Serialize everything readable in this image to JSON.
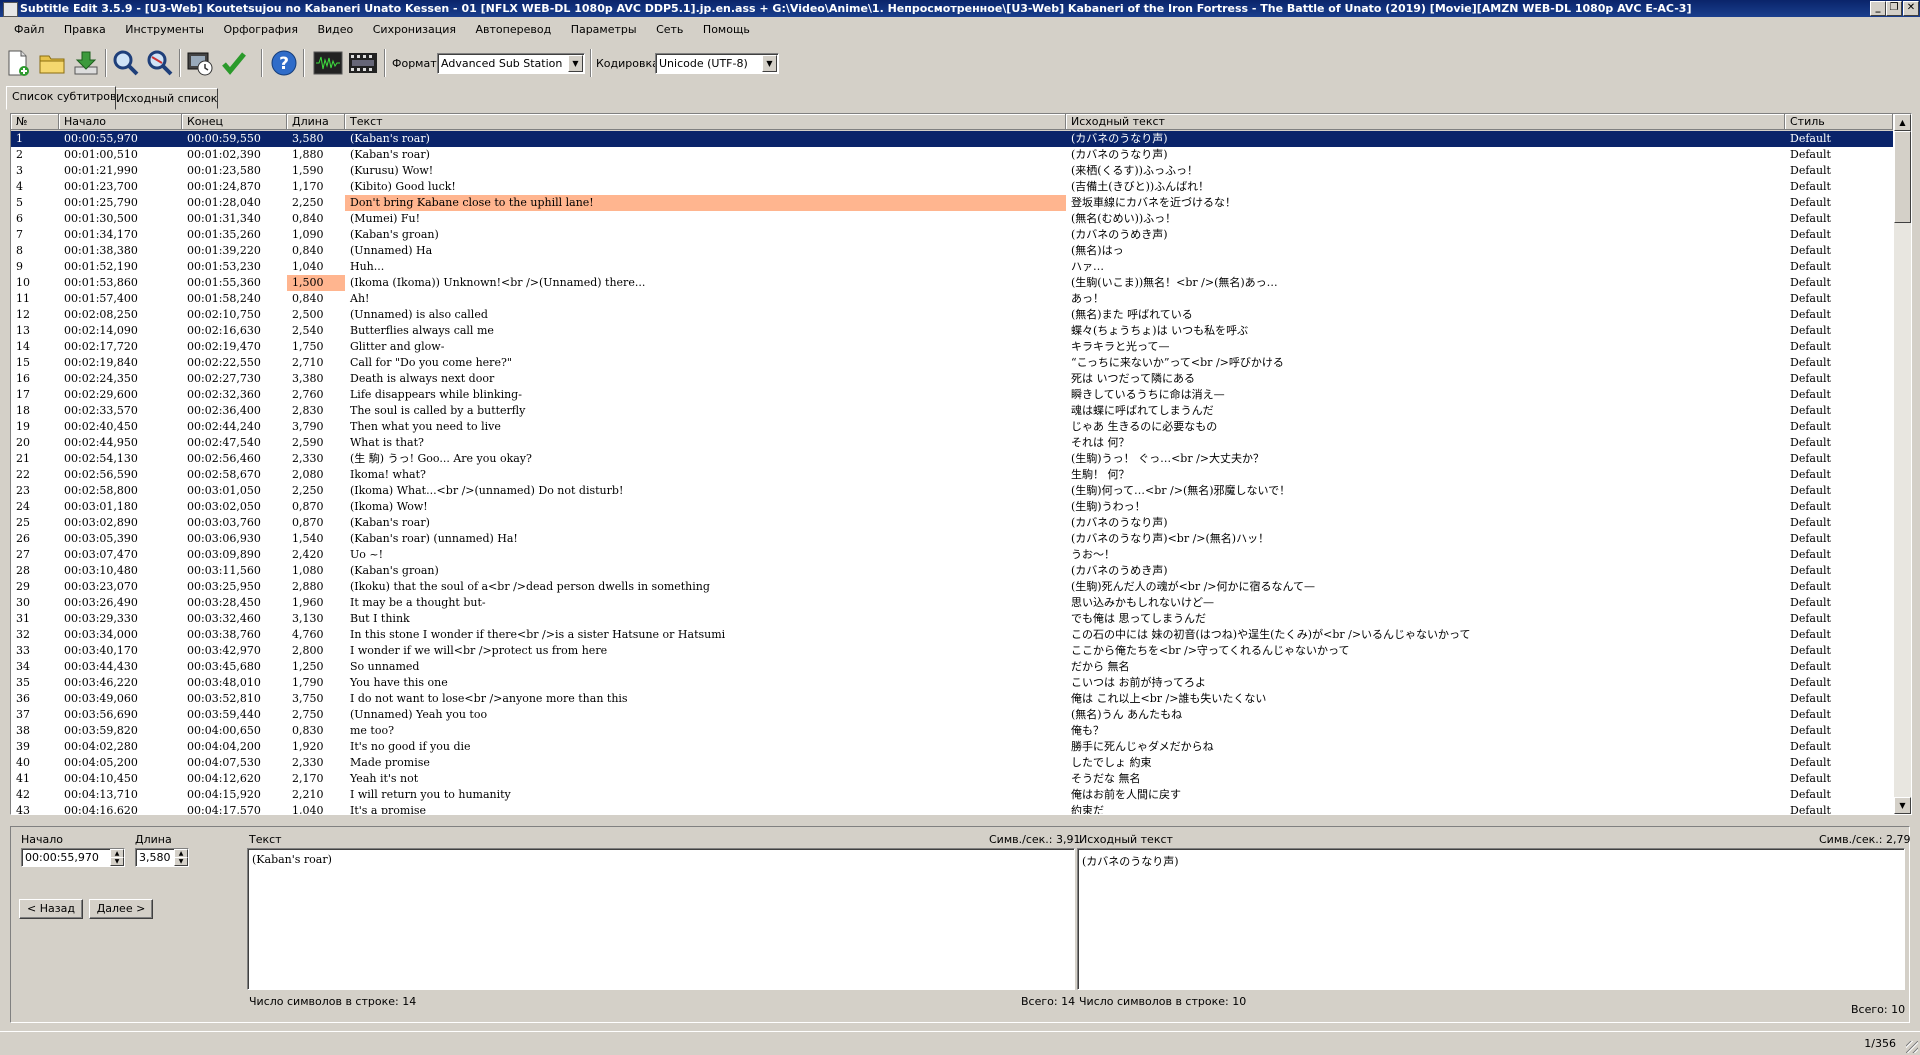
{
  "window": {
    "title": "Subtitle Edit 3.5.9 - [U3-Web] Koutetsujou no Kabaneri Unato Kessen - 01 [NFLX WEB-DL 1080p AVC DDP5.1].jp.en.ass + G:\\Video\\Anime\\1. Непросмотренное\\[U3-Web] Kabaneri of the Iron Fortress - The Battle of Unato (2019) [Movie][AMZN WEB-DL 1080p AVC E-AC-3]"
  },
  "menu": [
    "Файл",
    "Правка",
    "Инструменты",
    "Орфография",
    "Видео",
    "Сихронизация",
    "Автоперевод",
    "Параметры",
    "Сеть",
    "Помощь"
  ],
  "toolbar": {
    "icons": [
      "new-file-icon",
      "open-folder-icon",
      "download-icon",
      "find-icon",
      "replace-icon",
      "visual-sync-icon",
      "spell-check-icon",
      "help-icon",
      "waveform-icon",
      "video-icon"
    ],
    "format_label": "Формат",
    "format_value": "Advanced Sub Station Alpha",
    "encoding_label": "Кодировка",
    "encoding_value": "Unicode (UTF-8)"
  },
  "tabs": [
    "Список субтитров",
    "Исходный список"
  ],
  "grid": {
    "columns": [
      "№",
      "Начало",
      "Конец",
      "Длина",
      "Текст",
      "Исходный текст",
      "Стиль"
    ],
    "rows": [
      [
        "1",
        "00:00:55,970",
        "00:00:59,550",
        "3,580",
        "(Kaban's roar)",
        "(カバネのうなり声)",
        "Default"
      ],
      [
        "2",
        "00:01:00,510",
        "00:01:02,390",
        "1,880",
        "(Kaban's roar)",
        "(カバネのうなり声)",
        "Default"
      ],
      [
        "3",
        "00:01:21,990",
        "00:01:23,580",
        "1,590",
        "(Kurusu) Wow!",
        "(来栖(くるす))ふっふっ！",
        "Default"
      ],
      [
        "4",
        "00:01:23,700",
        "00:01:24,870",
        "1,170",
        "(Kibito) Good luck!",
        "(吉備土(きびと))ふんばれ！",
        "Default"
      ],
      [
        "5",
        "00:01:25,790",
        "00:01:28,040",
        "2,250",
        "Don't bring Kabane close to the uphill lane!",
        "登坂車線にカバネを近づけるな！",
        "Default"
      ],
      [
        "6",
        "00:01:30,500",
        "00:01:31,340",
        "0,840",
        "(Mumei) Fu!",
        "(無名(むめい))ふっ！",
        "Default"
      ],
      [
        "7",
        "00:01:34,170",
        "00:01:35,260",
        "1,090",
        "(Kaban's groan)",
        "(カバネのうめき声)",
        "Default"
      ],
      [
        "8",
        "00:01:38,380",
        "00:01:39,220",
        "0,840",
        "(Unnamed) Ha",
        "(無名)はっ",
        "Default"
      ],
      [
        "9",
        "00:01:52,190",
        "00:01:53,230",
        "1,040",
        "Huh...",
        "ハァ…",
        "Default"
      ],
      [
        "10",
        "00:01:53,860",
        "00:01:55,360",
        "1,500",
        "(Ikoma (Ikoma)) Unknown!<br />(Unnamed) there...",
        "(生駒(いこま))無名！<br />(無名)あっ…",
        "Default"
      ],
      [
        "11",
        "00:01:57,400",
        "00:01:58,240",
        "0,840",
        "Ah!",
        "あっ！",
        "Default"
      ],
      [
        "12",
        "00:02:08,250",
        "00:02:10,750",
        "2,500",
        "(Unnamed) is also called",
        "(無名)また 呼ばれている",
        "Default"
      ],
      [
        "13",
        "00:02:14,090",
        "00:02:16,630",
        "2,540",
        "Butterflies always call me",
        "蝶々(ちょうちょ)は いつも私を呼ぶ",
        "Default"
      ],
      [
        "14",
        "00:02:17,720",
        "00:02:19,470",
        "1,750",
        "Glitter and glow-",
        "キラキラと光って—",
        "Default"
      ],
      [
        "15",
        "00:02:19,840",
        "00:02:22,550",
        "2,710",
        "Call for \"Do you come here?\"",
        "“こっちに来ないか”って<br />呼びかける",
        "Default"
      ],
      [
        "16",
        "00:02:24,350",
        "00:02:27,730",
        "3,380",
        "Death is always next door",
        "死は いつだって隣にある",
        "Default"
      ],
      [
        "17",
        "00:02:29,600",
        "00:02:32,360",
        "2,760",
        "Life disappears while blinking-",
        "瞬きしているうちに命は消え—",
        "Default"
      ],
      [
        "18",
        "00:02:33,570",
        "00:02:36,400",
        "2,830",
        "The soul is called by a butterfly",
        "魂は蝶に呼ばれてしまうんだ",
        "Default"
      ],
      [
        "19",
        "00:02:40,450",
        "00:02:44,240",
        "3,790",
        "Then what you need to live",
        "じゃあ 生きるのに必要なもの",
        "Default"
      ],
      [
        "20",
        "00:02:44,950",
        "00:02:47,540",
        "2,590",
        "What is that?",
        "それは 何？",
        "Default"
      ],
      [
        "21",
        "00:02:54,130",
        "00:02:56,460",
        "2,330",
        "(生 駒) うっ! Goo... Are you okay?",
        "(生駒)うっ！ ぐっ…<br />大丈夫か？",
        "Default"
      ],
      [
        "22",
        "00:02:56,590",
        "00:02:58,670",
        "2,080",
        "Ikoma! what?",
        "生駒！ 何？",
        "Default"
      ],
      [
        "23",
        "00:02:58,800",
        "00:03:01,050",
        "2,250",
        "(Ikoma) What...<br />(unnamed) Do not disturb!",
        "(生駒)何って…<br />(無名)邪魔しないで！",
        "Default"
      ],
      [
        "24",
        "00:03:01,180",
        "00:03:02,050",
        "0,870",
        "(Ikoma) Wow!",
        "(生駒)うわっ！",
        "Default"
      ],
      [
        "25",
        "00:03:02,890",
        "00:03:03,760",
        "0,870",
        "(Kaban's roar)",
        "(カバネのうなり声)",
        "Default"
      ],
      [
        "26",
        "00:03:05,390",
        "00:03:06,930",
        "1,540",
        "(Kaban's roar) (unnamed) Ha!",
        "(カバネのうなり声)<br />(無名)ハッ！",
        "Default"
      ],
      [
        "27",
        "00:03:07,470",
        "00:03:09,890",
        "2,420",
        "Uo ~!",
        "うお～！",
        "Default"
      ],
      [
        "28",
        "00:03:10,480",
        "00:03:11,560",
        "1,080",
        "(Kaban's groan)",
        "(カバネのうめき声)",
        "Default"
      ],
      [
        "29",
        "00:03:23,070",
        "00:03:25,950",
        "2,880",
        "(Ikoku) that the soul of a<br />dead person dwells in something",
        "(生駒)死んだ人の魂が<br />何かに宿るなんて—",
        "Default"
      ],
      [
        "30",
        "00:03:26,490",
        "00:03:28,450",
        "1,960",
        "It may be a thought but-",
        "思い込みかもしれないけど—",
        "Default"
      ],
      [
        "31",
        "00:03:29,330",
        "00:03:32,460",
        "3,130",
        "But I think",
        "でも俺は 思ってしまうんだ",
        "Default"
      ],
      [
        "32",
        "00:03:34,000",
        "00:03:38,760",
        "4,760",
        "In this stone I wonder if there<br />is a sister Hatsune or Hatsumi",
        "この石の中には 妹の初音(はつね)や逞生(たくみ)が<br />いるんじゃないかって",
        "Default"
      ],
      [
        "33",
        "00:03:40,170",
        "00:03:42,970",
        "2,800",
        "I wonder if we will<br />protect us from here",
        "ここから俺たちを<br />守ってくれるんじゃないかって",
        "Default"
      ],
      [
        "34",
        "00:03:44,430",
        "00:03:45,680",
        "1,250",
        "So unnamed",
        "だから 無名",
        "Default"
      ],
      [
        "35",
        "00:03:46,220",
        "00:03:48,010",
        "1,790",
        "You have this one",
        "こいつは お前が持ってろよ",
        "Default"
      ],
      [
        "36",
        "00:03:49,060",
        "00:03:52,810",
        "3,750",
        "I do not want to lose<br />anyone more than this",
        "俺は これ以上<br />誰も失いたくない",
        "Default"
      ],
      [
        "37",
        "00:03:56,690",
        "00:03:59,440",
        "2,750",
        "(Unnamed) Yeah you too",
        "(無名)うん あんたもね",
        "Default"
      ],
      [
        "38",
        "00:03:59,820",
        "00:04:00,650",
        "0,830",
        "me too?",
        "俺も？",
        "Default"
      ],
      [
        "39",
        "00:04:02,280",
        "00:04:04,200",
        "1,920",
        "It's no good if you die",
        "勝手に死んじゃダメだからね",
        "Default"
      ],
      [
        "40",
        "00:04:05,200",
        "00:04:07,530",
        "2,330",
        "Made promise",
        "したでしょ 約束",
        "Default"
      ],
      [
        "41",
        "00:04:10,450",
        "00:04:12,620",
        "2,170",
        "Yeah it's not",
        "そうだな 無名",
        "Default"
      ],
      [
        "42",
        "00:04:13,710",
        "00:04:15,920",
        "2,210",
        "I will return you to humanity",
        "俺はお前を人間に戻す",
        "Default"
      ],
      [
        "43",
        "00:04:16,620",
        "00:04:17,570",
        "1,040",
        "It's a promise",
        "約束だ",
        "Default"
      ]
    ],
    "selected_row": 0,
    "warn_text_row": 4,
    "warn_duration_row": 9,
    "selection_color": "#0a246a",
    "warn_color": "#ffb58f"
  },
  "editor": {
    "start_label": "Начало",
    "start_value": "00:00:55,970",
    "duration_label": "Длина",
    "duration_value": "3,580",
    "prev_label": "< Назад",
    "next_label": "Далее >",
    "text_label": "Текст",
    "text_cps": "Симв./сек.: 3,91",
    "text_value": "(Kaban's roar)",
    "text_line_count": "Число символов в строке: 14",
    "text_total": "Всего: 14",
    "orig_label": "Исходный текст",
    "orig_cps": "Симв./сек.: 2,79",
    "orig_value": "(カバネのうなり声)",
    "orig_line_count": "Число символов в строке: 10",
    "orig_total": "Всего: 10"
  },
  "status": {
    "position": "1/356"
  }
}
